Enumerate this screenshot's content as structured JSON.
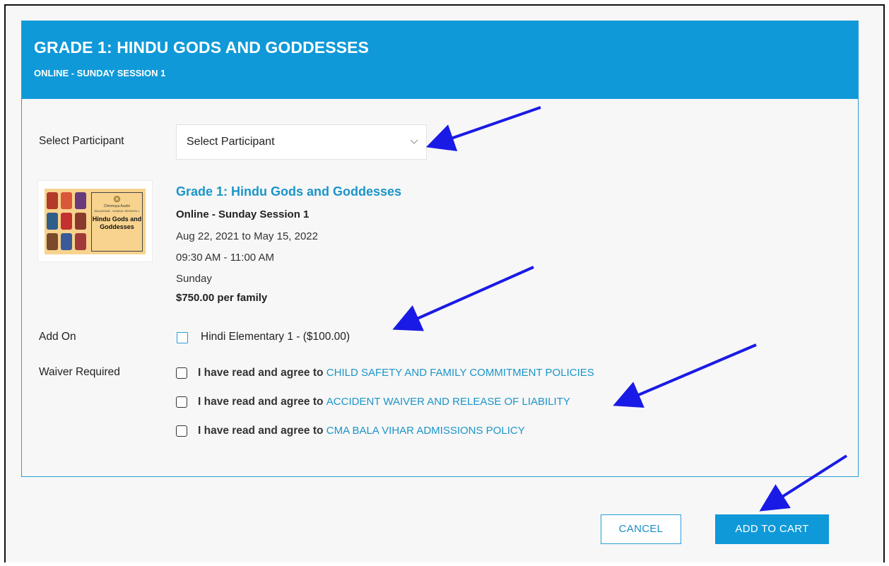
{
  "header": {
    "title": "GRADE 1: HINDU GODS AND GODDESSES",
    "subtitle": "ONLINE - SUNDAY SESSION 1"
  },
  "participant": {
    "label": "Select Participant",
    "select_value": "Select Participant"
  },
  "product": {
    "title": "Grade 1: Hindu Gods and Goddesses",
    "session": "Online - Sunday Session 1",
    "dates": "Aug 22, 2021 to May 15, 2022",
    "time": "09:30 AM - 11:00 AM",
    "day": "Sunday",
    "price": "$750.00 per family",
    "thumbnail": {
      "org": "Chinmaya Austin",
      "line": "BALAVIHAR - SUNDAY SESSION 1",
      "title": "Hindu Gods and Goddesses"
    }
  },
  "addon": {
    "label": "Add On",
    "option": "Hindi Elementary 1 - ($100.00)"
  },
  "waiver": {
    "label": "Waiver Required",
    "prefix": "I have read and agree to",
    "items": [
      "CHILD SAFETY AND FAMILY COMMITMENT POLICIES",
      "ACCIDENT WAIVER AND RELEASE OF LIABILITY",
      "CMA BALA VIHAR ADMISSIONS POLICY"
    ]
  },
  "buttons": {
    "cancel": "CANCEL",
    "add_to_cart": "ADD TO CART"
  },
  "colors": {
    "brand_blue": "#0f99d8",
    "link_blue": "#1b95c9",
    "annotation_arrow": "#1a1ae6"
  },
  "icons": {
    "select_chevron": "chevron-down-icon",
    "annotation": "arrow-icon"
  }
}
